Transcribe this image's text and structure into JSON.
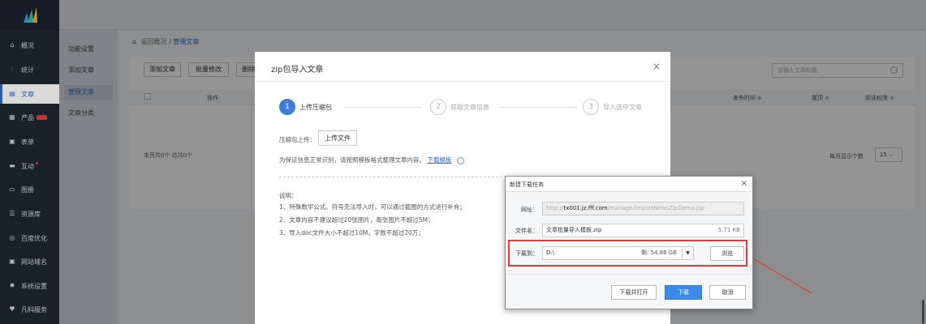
{
  "sidebar": {
    "items": [
      {
        "label": "概况",
        "icon": "home-icon"
      },
      {
        "label": "统计",
        "icon": "chart-icon"
      },
      {
        "label": "文章",
        "icon": "document-icon",
        "active": true
      },
      {
        "label": "产品",
        "icon": "grid-icon",
        "badge": "hot"
      },
      {
        "label": "表单",
        "icon": "form-icon"
      },
      {
        "label": "互动",
        "icon": "chat-icon",
        "dot": true
      },
      {
        "label": "图册",
        "icon": "image-icon"
      },
      {
        "label": "资源库",
        "icon": "database-icon"
      },
      {
        "label": "百度优化",
        "icon": "seo-icon"
      },
      {
        "label": "网站域名",
        "icon": "domain-icon"
      },
      {
        "label": "系统设置",
        "icon": "gear-icon"
      },
      {
        "label": "凡科服务",
        "icon": "heart-icon"
      }
    ]
  },
  "subnav": {
    "items": [
      "功能设置",
      "添加文章",
      "管理文章",
      "文章分类"
    ]
  },
  "breadcrumb": {
    "back": "返回概况",
    "separator": "/",
    "current": "管理文章"
  },
  "toolbar": {
    "add": "添加文章",
    "batch": "批量修改",
    "delete": "删除"
  },
  "search": {
    "placeholder": "请输入文章标题"
  },
  "table": {
    "headers": {
      "op": "操作",
      "publish": "发布时间 ≎",
      "top": "置顶 ≎",
      "perm": "阅读权限 ≎"
    }
  },
  "footer": {
    "summary": "本页共0个  总共0个",
    "per_page_label": "每页显示个数",
    "per_page": "15"
  },
  "zip_dialog": {
    "title": "zip包导入文章",
    "close": "×",
    "steps": [
      {
        "num": "1",
        "label": "上传压缩包"
      },
      {
        "num": "2",
        "label": "获取文章信息"
      },
      {
        "num": "3",
        "label": "导入选中文章"
      }
    ],
    "upload_label": "压缩包上传：",
    "upload_button": "上传文件",
    "hint": "为保证信息正常识别，请按照模板格式整理文章内容。",
    "template_link": "下载模板",
    "notes_title": "说明：",
    "notes": [
      "1、特殊数学公式、符号无法导入时，可以通过截图的方式进行补充；",
      "2、文章内容不建议超过20张图片，每张图片不超过5M；",
      "3、导入doc文件大小不超过10M，字数不超过20万；"
    ]
  },
  "download_dialog": {
    "title": "新建下载任务",
    "close": "×",
    "url_label": "网址：",
    "url_prefix": "http://",
    "url_host": "tx001.jz.fff.com",
    "url_path": "/manage/importNewsZipDemo.jsp",
    "filename_label": "文件名：",
    "filename": "文章批量导入模板.zip",
    "file_size": "5.71 KB",
    "saveto_label": "下载到：",
    "saveto": "D:\\",
    "free_space": "剩: 54.86 GB",
    "browse": "浏览",
    "open_after": "下载并打开",
    "download": "下载",
    "cancel": "取消"
  },
  "colors": {
    "accent": "#3b7ed8",
    "sidebar": "#1e2733",
    "highlight": "#e53935"
  }
}
